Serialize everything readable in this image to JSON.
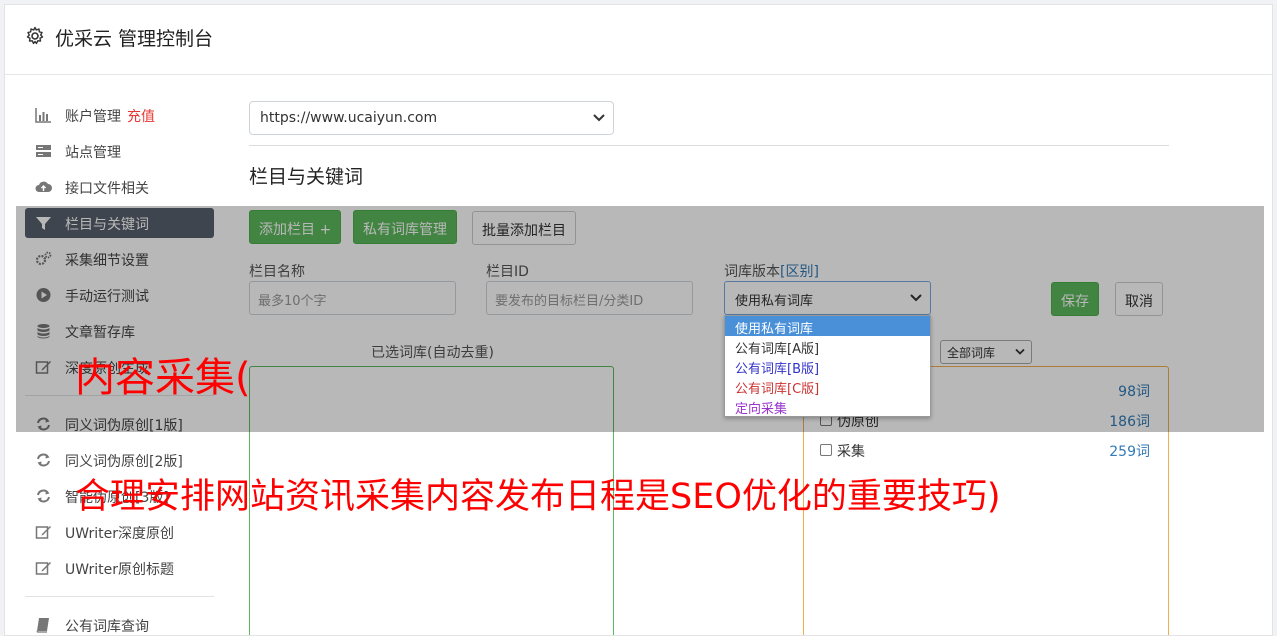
{
  "header": {
    "title": "优采云 管理控制台"
  },
  "sidebar": {
    "items": [
      {
        "label": "账户管理",
        "extra": "充值",
        "icon": "bar-chart-icon"
      },
      {
        "label": "站点管理",
        "icon": "server-icon"
      },
      {
        "label": "接口文件相关",
        "icon": "cloud-upload-icon"
      },
      {
        "label": "栏目与关键词",
        "icon": "filter-icon",
        "active": true
      },
      {
        "label": "采集细节设置",
        "icon": "cogs-icon"
      },
      {
        "label": "手动运行测试",
        "icon": "play-circle-icon"
      },
      {
        "label": "文章暂存库",
        "icon": "database-icon"
      },
      {
        "label": "深度原创生成",
        "icon": "edit-icon"
      },
      {
        "label": "同义词伪原创[1版]",
        "icon": "refresh-icon"
      },
      {
        "label": "同义词伪原创[2版]",
        "icon": "refresh-icon"
      },
      {
        "label": "智能伪原创[3版]",
        "icon": "refresh-icon"
      },
      {
        "label": "UWriter深度原创",
        "icon": "edit-icon"
      },
      {
        "label": "UWriter原创标题",
        "icon": "edit-icon"
      },
      {
        "label": "公有词库查询",
        "icon": "book-icon"
      }
    ]
  },
  "main": {
    "site_select": "https://www.ucaiyun.com",
    "section_title": "栏目与关键词",
    "buttons": {
      "add_column": "添加栏目 +",
      "private_lib": "私有词库管理",
      "batch_add": "批量添加栏目",
      "save": "保存",
      "cancel": "取消"
    },
    "form": {
      "name_label": "栏目名称",
      "name_placeholder": "最多10个字",
      "id_label": "栏目ID",
      "id_placeholder": "要发布的目标栏目/分类ID",
      "lib_label": "词库版本",
      "lib_label_link": "[区别]",
      "lib_select": "使用私有词库",
      "lib_options": [
        {
          "label": "使用私有词库",
          "color": "#ffffff"
        },
        {
          "label": "公有词库[A版]",
          "color": "#333333"
        },
        {
          "label": "公有词库[B版]",
          "color": "#3333cc"
        },
        {
          "label": "公有词库[C版]",
          "color": "#cc3333"
        },
        {
          "label": "定向采集",
          "color": "#9933cc"
        }
      ]
    },
    "selected_caption": "已选词库(自动去重)",
    "filter_select": "全部词库",
    "libraries": [
      {
        "name": "",
        "count": "98词"
      },
      {
        "name": "伪原创",
        "count": "186词"
      },
      {
        "name": "采集",
        "count": "259词"
      }
    ]
  },
  "overlay_text": {
    "line1": "内容采集(",
    "line2": "合理安排网站资讯采集内容发布日程是SEO优化的重要技巧)"
  },
  "colors": {
    "accent_green": "#5cb85c",
    "active_nav": "#58606c",
    "overlay_red": "#ff0000",
    "link_blue": "#337ab7",
    "orange_border": "#f0ad4e"
  }
}
